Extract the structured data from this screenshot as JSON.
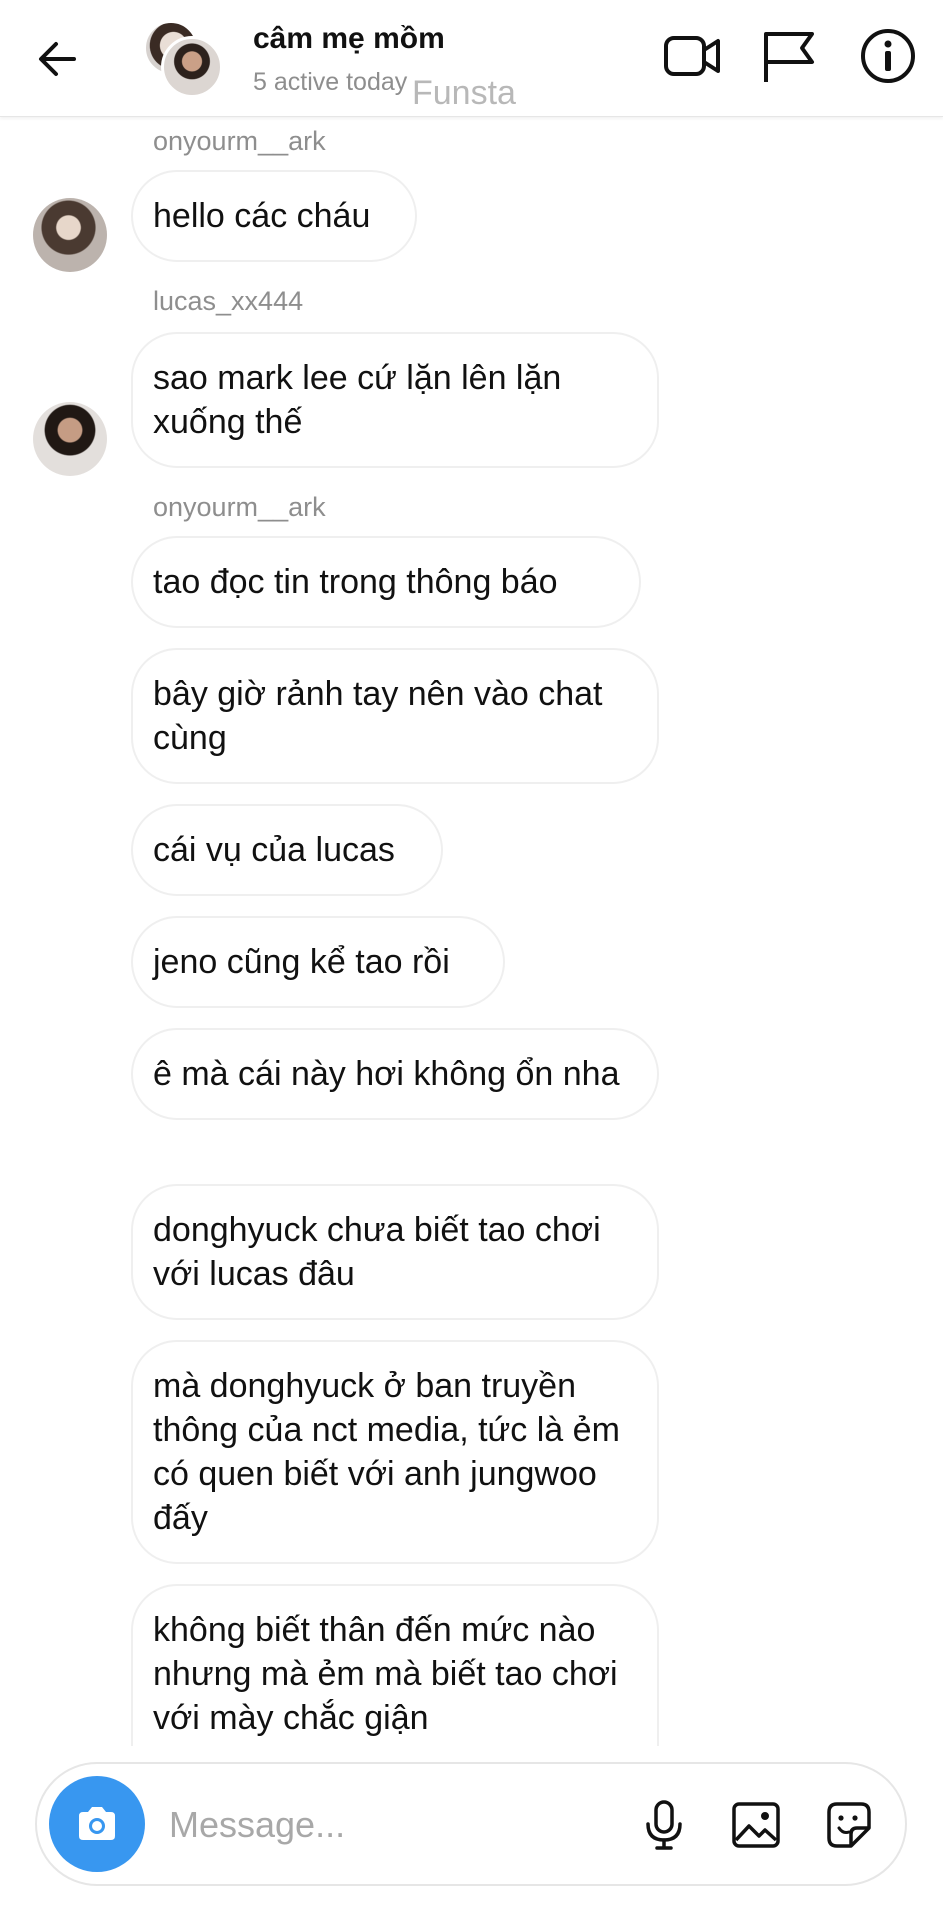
{
  "header": {
    "title": "câm mẹ mồm",
    "status": "5 active today",
    "watermark": "Funsta",
    "icons": [
      "back-arrow-icon",
      "video-camera-icon",
      "flag-icon",
      "info-icon"
    ]
  },
  "messages": [
    {
      "sender": "onyourm__ark",
      "text": "hello các cháu"
    },
    {
      "sender": "lucas_xx444",
      "text": "sao mark lee cứ lặn lên lặn xuống thế"
    },
    {
      "sender": "onyourm__ark",
      "text": "tao đọc tin trong thông báo"
    },
    {
      "text": "bây giờ rảnh tay nên vào chat cùng"
    },
    {
      "text": "cái vụ của lucas"
    },
    {
      "text": "jeno cũng kể tao rồi"
    },
    {
      "text": "ê mà cái này hơi không ổn nha"
    },
    {
      "text": "donghyuck chưa biết tao chơi với lucas đâu"
    },
    {
      "text": "mà donghyuck ở ban truyền thông của nct media, tức là ẻm có quen biết với anh jungwoo đấy"
    },
    {
      "text": "không biết thân đến mức nào nhưng mà ẻm mà biết tao chơi với mày chắc giận"
    }
  ],
  "composer": {
    "placeholder": "Message...",
    "icons": [
      "camera-icon",
      "microphone-icon",
      "gallery-icon",
      "sticker-icon"
    ]
  },
  "colors": {
    "accent": "#3897f0",
    "bubble_border": "#efefef",
    "muted_text": "#8e8e8e"
  }
}
